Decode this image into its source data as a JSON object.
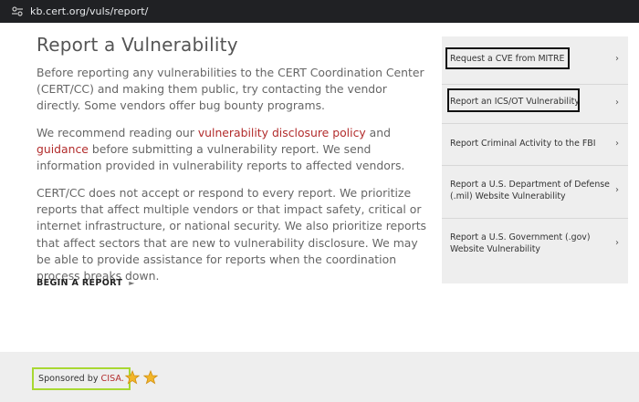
{
  "browser": {
    "url": "kb.cert.org/vuls/report/"
  },
  "main": {
    "title": "Report a Vulnerability",
    "p1": "Before reporting any vulnerabilities to the CERT Coordination Center (CERT/CC) and making them public, try contacting the vendor directly. Some vendors offer bug bounty programs.",
    "p2_before": "We recommend reading our ",
    "p2_link1": "vulnerability disclosure policy",
    "p2_mid": " and ",
    "p2_link2": "guidance",
    "p2_after": " before submitting a vulnerability report. We send information provided in vulnerability reports to affected vendors.",
    "p3": "CERT/CC does not accept or respond to every report. We prioritize reports that affect multiple vendors or that impact safety, critical or internet infrastructure, or national security. We also prioritize reports that affect sectors that are new to vulnerability disclosure. We may be able to provide assistance for reports when the coordination process breaks down.",
    "begin_label": "BEGIN A REPORT",
    "begin_arrow": "►"
  },
  "sidebar": {
    "chevron": "›",
    "items": [
      {
        "line1": "Request a CVE from MITRE",
        "line2": ""
      },
      {
        "line1": "Report an ICS/OT Vulnerability",
        "line2": ""
      },
      {
        "line1": "Report Criminal Activity to the FBI",
        "line2": ""
      },
      {
        "line1": "Report a U.S. Department of Defense",
        "line2": "(.mil) Website Vulnerability"
      },
      {
        "line1": "Report a U.S. Government (.gov)",
        "line2": "Website Vulnerability"
      }
    ]
  },
  "footer": {
    "sponsored_text": "Sponsored by ",
    "sponsor_link": "CISA.",
    "star_color": "#f2b62b"
  },
  "colors": {
    "link": "#b22c2c",
    "sponsor_border": "#a8d832"
  }
}
